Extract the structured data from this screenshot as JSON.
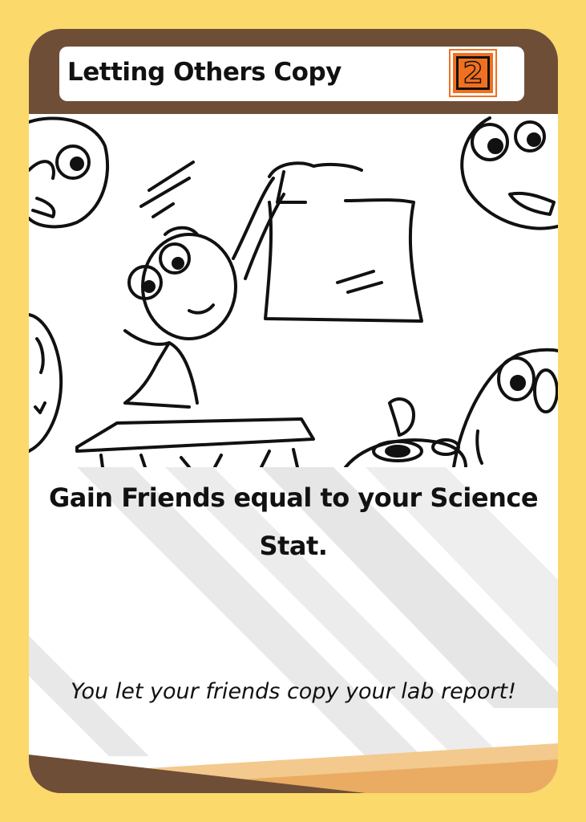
{
  "card": {
    "title": "Letting Others Copy",
    "cost": "2",
    "effect": "Gain Friends equal to your Science Stat.",
    "flavor": "You let your friends copy your lab report!"
  },
  "colors": {
    "background": "#fbd96a",
    "header": "#6f4e38",
    "cost_badge": "#f07020",
    "footer_light": "#f3c98e",
    "footer_mid": "#e9ac62"
  },
  "illustration": {
    "icon": "student-holding-paper-illustration"
  }
}
